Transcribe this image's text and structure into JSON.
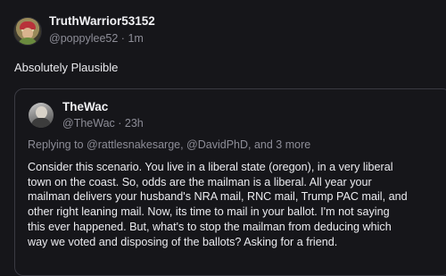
{
  "post": {
    "author_name": "TruthWarrior53152",
    "author_handle": "@poppylee52 · 1m",
    "text": "Absolutely Plausible"
  },
  "quoted_post": {
    "author_name": "TheWac",
    "author_handle": "@TheWac · 23h",
    "reply_to": "Replying to @rattlesnakesarge, @DavidPhD, and 3 more",
    "lines": [
      "Consider this scenario.  You live in a liberal state (oregon), in a very liberal",
      "town on the coast.  So, odds are the mailman is a liberal.  All year your",
      "mailman delivers your husband's NRA mail, RNC mail, Trump PAC mail, and",
      "other right leaning mail.  Now, its time to mail in your ballot.   I'm not saying",
      "this ever happened.  But, what's to stop the mailman from deducing which",
      "way we voted and disposing of the ballots?  Asking for a friend."
    ]
  }
}
